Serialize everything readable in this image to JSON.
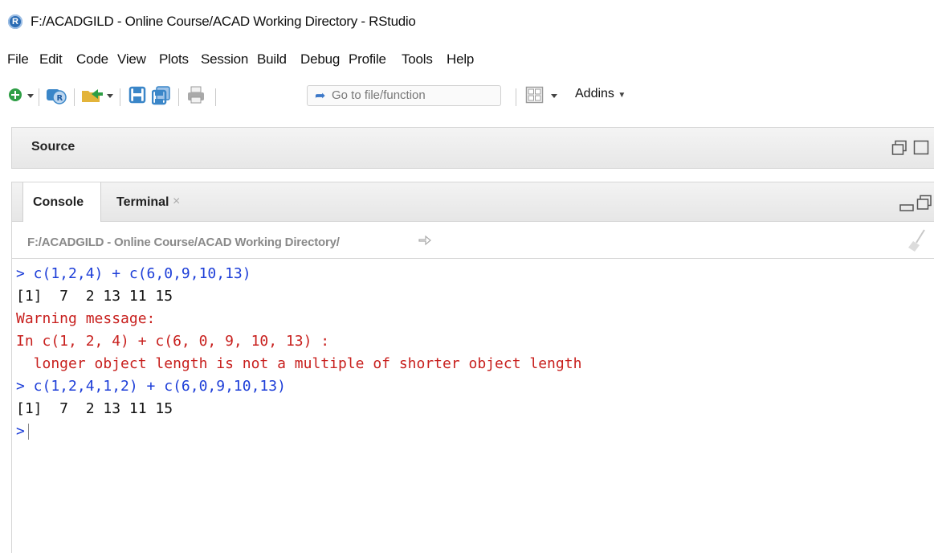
{
  "window": {
    "title": "F:/ACADGILD - Online Course/ACAD Working Directory - RStudio"
  },
  "menu": [
    "File",
    "Edit",
    "Code",
    "View",
    "Plots",
    "Session",
    "Build",
    "Debug",
    "Profile",
    "Tools",
    "Help"
  ],
  "toolbar": {
    "goto_placeholder": "Go to file/function",
    "addins_label": "Addins"
  },
  "source": {
    "label": "Source"
  },
  "console": {
    "tabs": {
      "console": "Console",
      "terminal": "Terminal"
    },
    "path": "F:/ACADGILD - Online Course/ACAD Working Directory/",
    "lines": [
      "> c(1,2,4) + c(6,0,9,10,13)",
      "[1]  7  2 13 11 15",
      "Warning message:",
      "In c(1, 2, 4) + c(6, 0, 9, 10, 13) :",
      "  longer object length is not a multiple of shorter object length",
      "> c(1,2,4,1,2) + c(6,0,9,10,13)",
      "[1]  7  2 13 11 15",
      ">"
    ]
  }
}
